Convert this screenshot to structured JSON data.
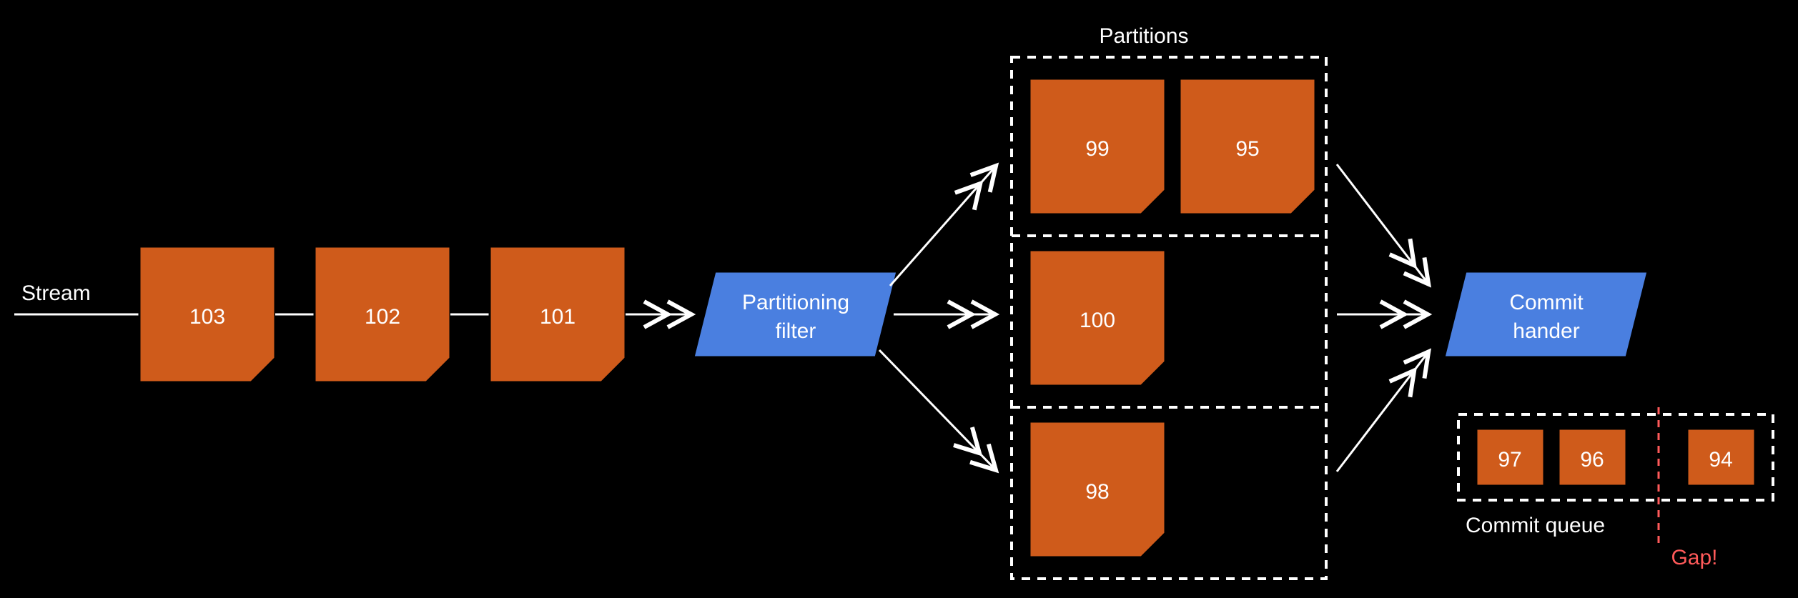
{
  "labels": {
    "stream": "Stream",
    "partitions": "Partitions",
    "commit_queue": "Commit queue",
    "gap": "Gap!"
  },
  "processors": {
    "filter_line1": "Partitioning",
    "filter_line2": "filter",
    "commit_line1": "Commit",
    "commit_line2": "hander"
  },
  "stream_notes": [
    "103",
    "102",
    "101"
  ],
  "partitions": [
    [
      "99",
      "95"
    ],
    [
      "100"
    ],
    [
      "98"
    ]
  ],
  "commit_queue": [
    "97",
    "96",
    "94"
  ]
}
